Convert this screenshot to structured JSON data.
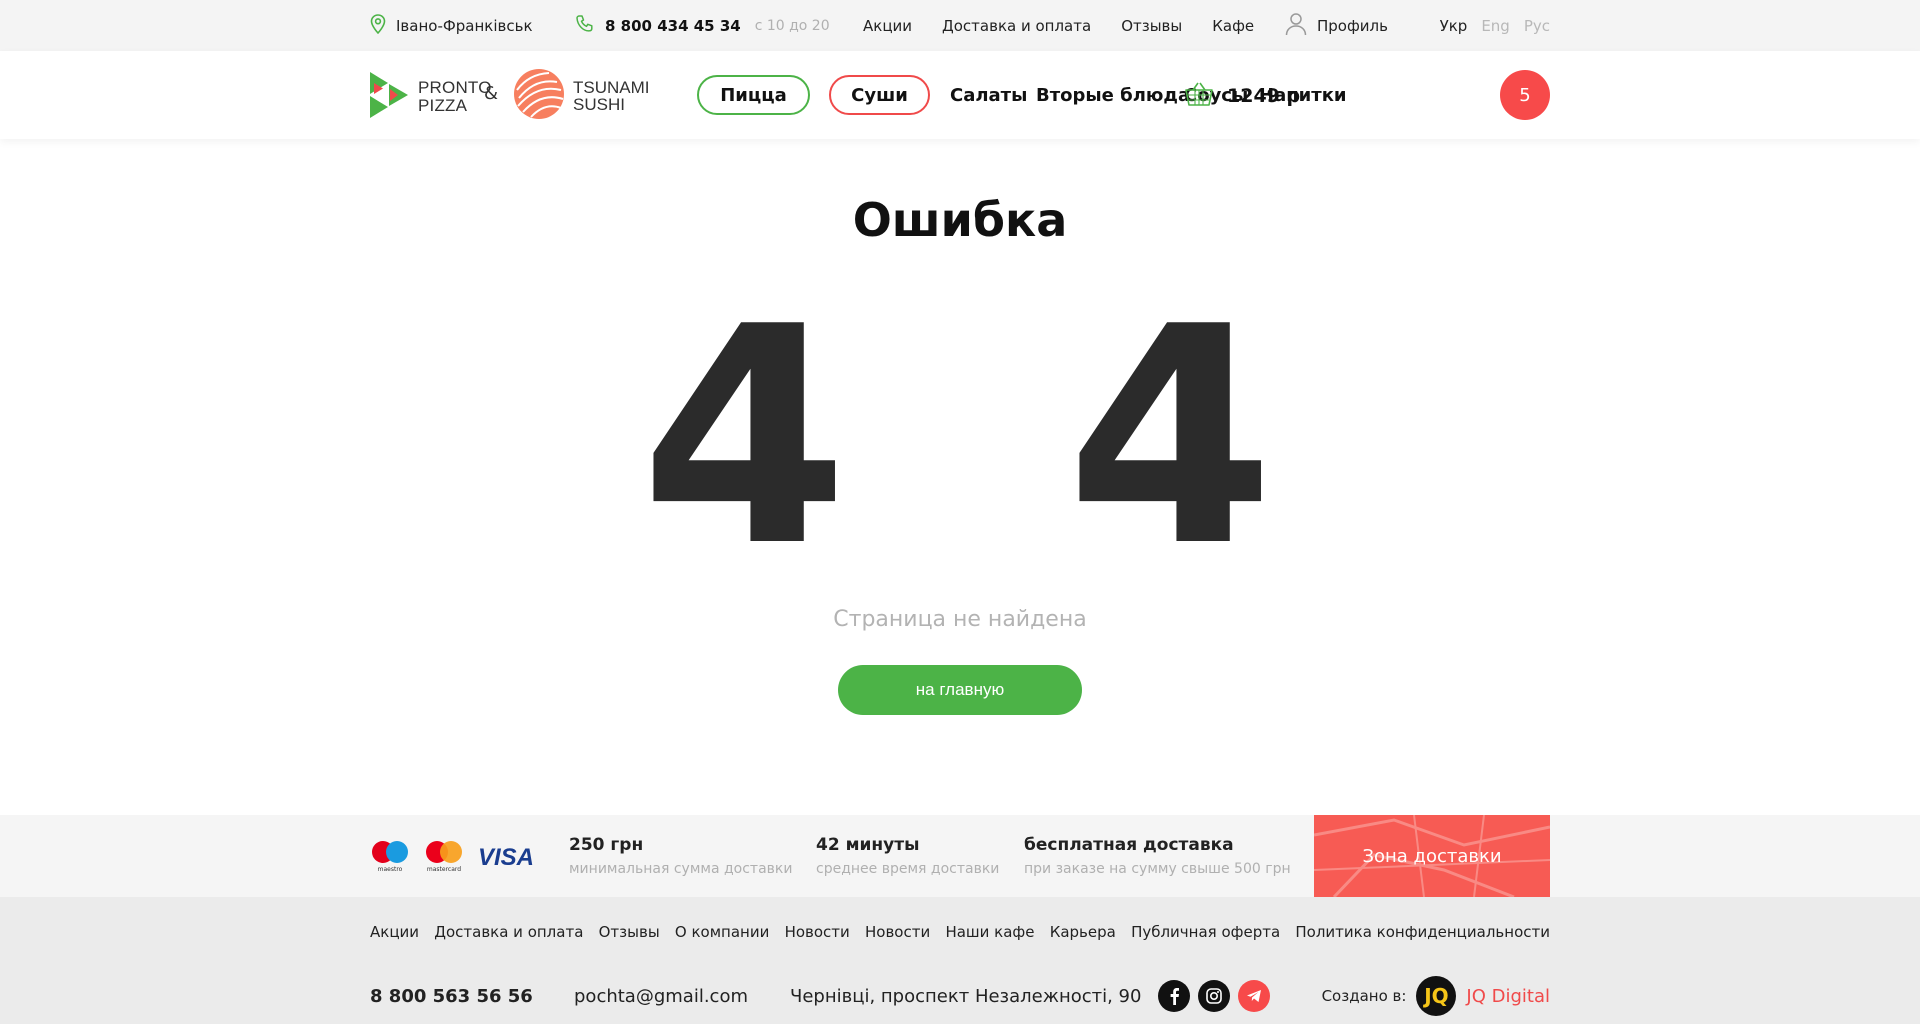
{
  "topbar": {
    "city": "Івано-Франківськ",
    "phone": "8 800 434 45 34",
    "hours": "с 10 до 20",
    "nav": [
      "Акции",
      "Доставка и оплата",
      "Отзывы",
      "Кафе"
    ],
    "profile": "Профиль",
    "languages": [
      {
        "label": "Укр",
        "active": true
      },
      {
        "label": "Eng",
        "active": false
      },
      {
        "label": "Рус",
        "active": false
      }
    ]
  },
  "header": {
    "logo_pronto_line1": "PRONTO",
    "logo_pronto_line2": "PIZZA",
    "amp": "&",
    "logo_tsunami_line1": "TSUNAMI",
    "logo_tsunami_line2": "SUSHI",
    "categories": [
      "Пицца",
      "Суши",
      "Салаты",
      "Вторые блюда",
      "Соусы",
      "Напитки"
    ],
    "cart_sum": "1249 р",
    "cart_count": "5"
  },
  "main": {
    "title": "Ошибка",
    "digit_left": "4",
    "digit_right": "4",
    "subtitle": "Страница не найдена",
    "home_button": "на главную"
  },
  "strip": {
    "payment_icons": [
      "maestro-icon",
      "mastercard-icon",
      "visa-icon"
    ],
    "maestro_label": "maestro",
    "mastercard_label": "mastercard",
    "visa_label": "VISA",
    "info": [
      {
        "value": "250 грн",
        "desc": "минимальная сумма доставки"
      },
      {
        "value": "42 минуты",
        "desc": "среднее время доставки"
      },
      {
        "value": "бесплатная доставка",
        "desc": "при заказе на сумму свыше 500 грн"
      }
    ],
    "zone_label": "Зона доставки"
  },
  "footer": {
    "nav": [
      "Акции",
      "Доставка и оплата",
      "Отзывы",
      "О компании",
      "Новости",
      "Новости",
      "Наши кафе",
      "Карьера",
      "Публичная оферта",
      "Политика конфиденциальности"
    ],
    "phone": "8 800 563 56 56",
    "email": "pochta@gmail.com",
    "address": "Чернівці, проспект Незалежності, 90",
    "social": [
      "facebook-icon",
      "instagram-icon",
      "telegram-icon"
    ],
    "made_by_label": "Создано в:",
    "made_by_logo": "JQ",
    "made_by_name": "JQ Digital"
  },
  "colors": {
    "green": "#4cb347",
    "red": "#f74a4a",
    "dark": "#2b2b2b"
  }
}
